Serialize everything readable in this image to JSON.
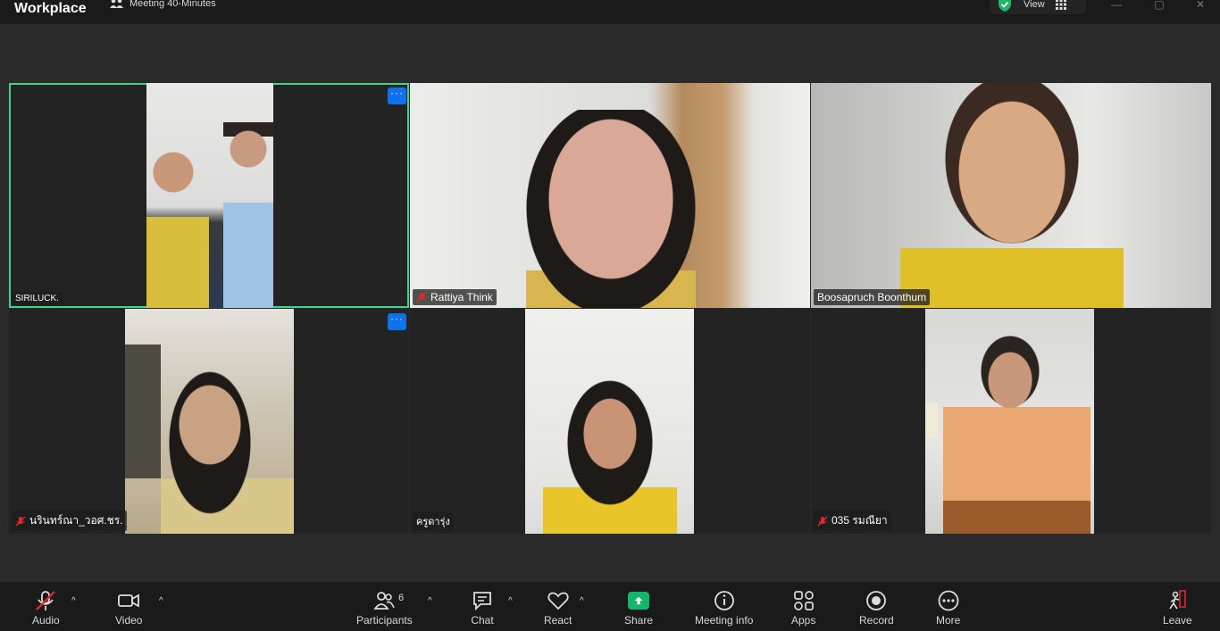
{
  "titlebar": {
    "app_name": "Workplace",
    "meeting_title": "Meeting 40-Minutes",
    "view_label": "View"
  },
  "tiles": [
    {
      "name": "SIRILUCK.",
      "muted": false,
      "active": true,
      "has_menu": true
    },
    {
      "name": "Rattiya Think",
      "muted": true,
      "active": false,
      "has_menu": false
    },
    {
      "name": "Boosapruch Boonthum",
      "muted": false,
      "active": false,
      "has_menu": false
    },
    {
      "name": "นรินทร์ณา_วอศ.ชร.",
      "muted": true,
      "active": false,
      "has_menu": true
    },
    {
      "name": "ครูดารุ่ง",
      "muted": false,
      "active": false,
      "has_menu": false
    },
    {
      "name": "035 รมณียา",
      "muted": true,
      "active": false,
      "has_menu": false
    }
  ],
  "tile_menu_label": "···",
  "toolbar": {
    "audio": "Audio",
    "video": "Video",
    "participants": "Participants",
    "participants_count": "6",
    "chat": "Chat",
    "react": "React",
    "share": "Share",
    "meeting_info": "Meeting info",
    "apps": "Apps",
    "record": "Record",
    "more": "More",
    "leave": "Leave"
  },
  "colors": {
    "active_border": "#3dd68c",
    "menu_blue": "#0e72ed",
    "share_green": "#12b76a",
    "mute_red": "#e02828"
  }
}
